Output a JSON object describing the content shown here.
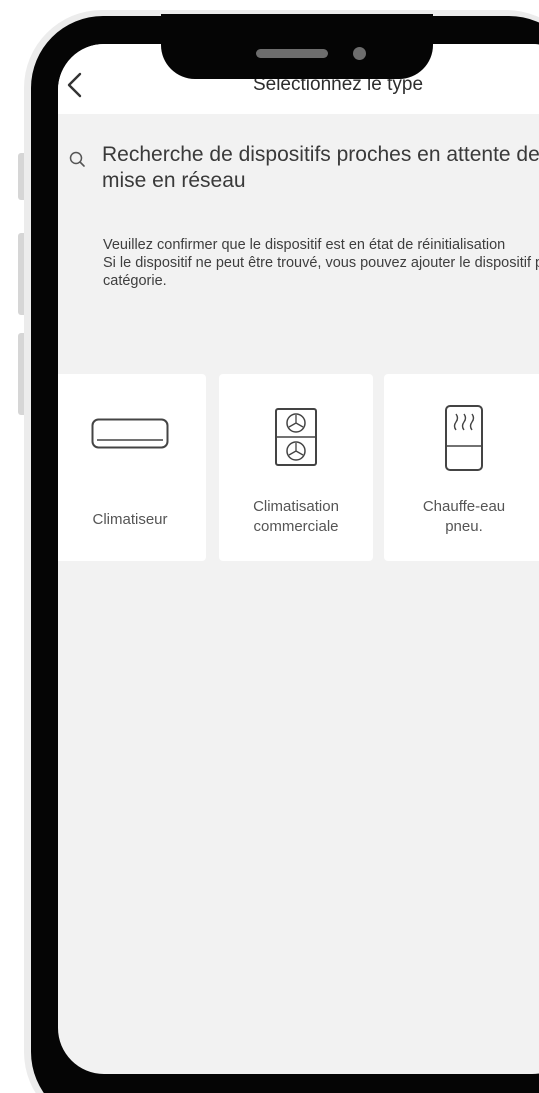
{
  "header": {
    "title": "Sélectionnez le type"
  },
  "search": {
    "status": "Recherche de dispositifs proches en attente de mise en réseau"
  },
  "info": {
    "line1": "Veuillez confirmer que le dispositif est en état de réinitialisation",
    "line2": "Si le dispositif ne peut être trouvé, vous pouvez ajouter le dispositif par catégorie."
  },
  "categories": [
    {
      "label": "Climatiseur",
      "icon": "air-conditioner-icon"
    },
    {
      "label_line1": "Climatisation",
      "label_line2": "commerciale",
      "icon": "commercial-ac-unit-icon"
    },
    {
      "label_line1": "Chauffe-eau",
      "label_line2": "pneu.",
      "icon": "water-heater-icon"
    }
  ]
}
